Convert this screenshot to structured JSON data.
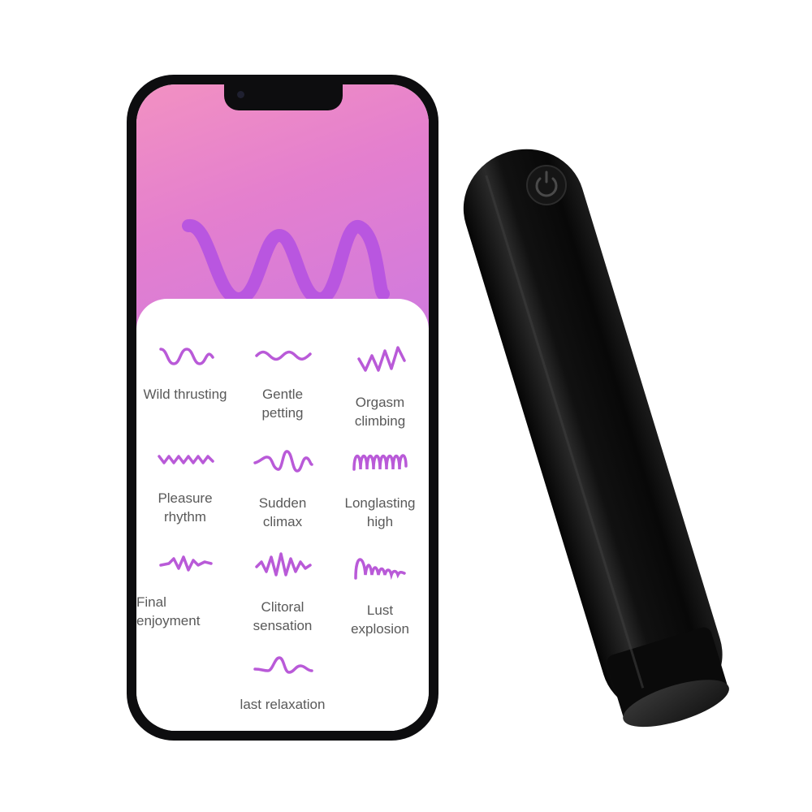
{
  "colors": {
    "accent": "#b95ad8",
    "hero_gradient_start": "#f291c2",
    "hero_gradient_end": "#d07ade",
    "text": "#595959"
  },
  "modes": [
    {
      "label": "Wild thrusting",
      "icon": "wild-thrusting-wave-icon"
    },
    {
      "label": "Gentle\npetting",
      "icon": "gentle-petting-wave-icon"
    },
    {
      "label": "Orgasm\nclimbing",
      "icon": "orgasm-climbing-wave-icon"
    },
    {
      "label": "Pleasure\nrhythm",
      "icon": "pleasure-rhythm-wave-icon"
    },
    {
      "label": "Sudden\nclimax",
      "icon": "sudden-climax-wave-icon"
    },
    {
      "label": "Longlasting\nhigh",
      "icon": "longlasting-high-wave-icon"
    },
    {
      "label": "Final\nenjoyment",
      "icon": "final-enjoyment-wave-icon"
    },
    {
      "label": "Clitoral\nsensation",
      "icon": "clitoral-sensation-wave-icon"
    },
    {
      "label": "Lust\nexplosion",
      "icon": "lust-explosion-wave-icon"
    },
    {
      "label": "last relaxation",
      "icon": "last-relaxation-wave-icon"
    }
  ]
}
